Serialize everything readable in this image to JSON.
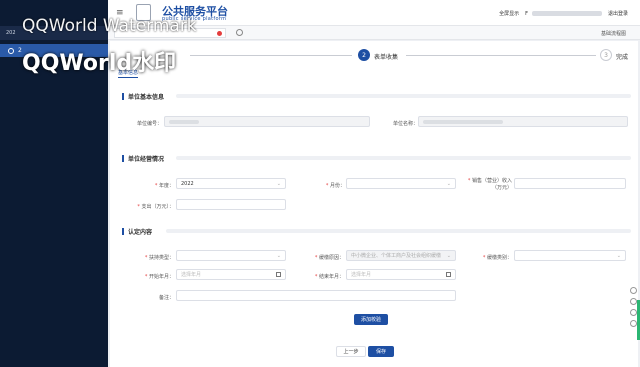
{
  "header": {
    "brand": "公共服务平台",
    "brand_sub": "public service platform",
    "fullscreen_label": "全屏显示",
    "user_initial": "F",
    "logout_label": "退出登录"
  },
  "tabs": {
    "flow_link": "基础流程图"
  },
  "sidebar": {
    "tab_text": "202",
    "item_label": "2"
  },
  "steps": [
    {
      "num": "",
      "label": ""
    },
    {
      "num": "2",
      "label": "表单收集"
    },
    {
      "num": "3",
      "label": "完成"
    }
  ],
  "breadcrumb": "基本信息",
  "sections": {
    "basic": {
      "title": "单位基本信息",
      "unit_no_label": "单位编号：",
      "unit_name_label": "单位名称："
    },
    "operation": {
      "title": "单位经营情况",
      "year_label": "年度：",
      "year_value": "2022",
      "month_label": "月份：",
      "revenue_label_1": "销售（营业）收入",
      "revenue_label_2": "（万元）",
      "expense_label": "支出（万元）："
    },
    "identify": {
      "title": "认定内容",
      "support_type_label": "扶持类型：",
      "reason_label": "缓缴原因：",
      "reason_placeholder": "中小微企业、个体工商户及社会组织缓缴",
      "category_label": "缓缴类别：",
      "start_label": "开始年月：",
      "start_placeholder": "选择年月",
      "end_label": "结束年月：",
      "end_placeholder": "选择年月",
      "remark_label": "备注："
    }
  },
  "buttons": {
    "add_check": "添加校验",
    "prev": "上一步",
    "save": "保存"
  },
  "watermark": {
    "line1": "QQWorld Watermark",
    "line2": "QQWorld水印"
  },
  "colors": {
    "primary": "#1e4fa3",
    "sidebar": "#0c1b33",
    "danger": "#e43d3d"
  }
}
